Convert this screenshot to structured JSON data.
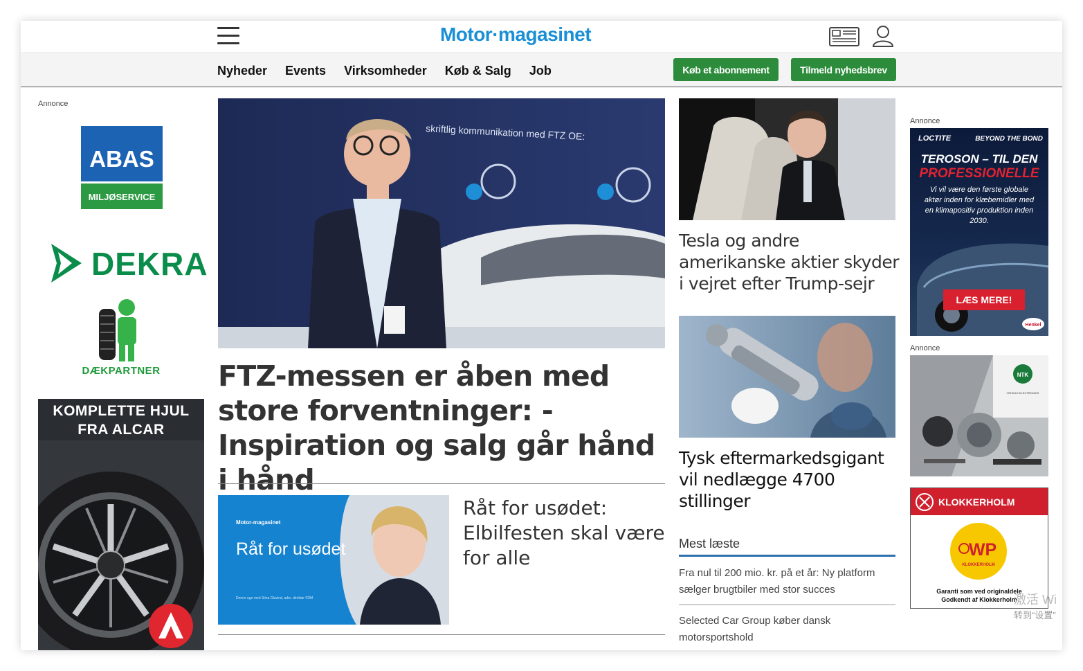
{
  "header": {
    "logo": "Motor·magasinet",
    "nav": [
      "Nyheder",
      "Events",
      "Virksomheder",
      "Køb & Salg",
      "Job"
    ],
    "subscribe_label": "Køb et abonnement",
    "newsletter_label": "Tilmeld nyhedsbrev"
  },
  "ads": {
    "annonce_label": "Annonce",
    "abas_top": "ABAS",
    "abas_bottom": "MILJØSERVICE",
    "dekra": "DEKRA",
    "daekpartner": "DÆKPARTNER",
    "alcar_title": "KOMPLETTE HJUL FRA ALCAR",
    "teroson_brand": "LOCTITE",
    "teroson_tag": "BEYOND THE BOND",
    "teroson_line1": "TEROSON – TIL DEN",
    "teroson_line2": "PROFESSIONELLE",
    "teroson_body": "Vi vil være den første globale aktør inden for klæbemidler med en klimapositiv produktion inden 2030.",
    "teroson_cta": "LÆS MERE!",
    "teroson_henkel": "Henkel",
    "ntk_brand": "NTK",
    "ntk_sub": "VEHICLE ELECTRONICS",
    "klok_name": "KLOKKERHOLM",
    "klok_wp": "WP",
    "klok_wp_sub": "KLOKKERHOLM",
    "klok_line1": "Garanti som ved originaldele",
    "klok_line2": "Godkendt af Klokkerholm"
  },
  "articles": {
    "hero_title": "FTZ-messen er åben med store forventninger: - Inspiration og salg går hånd i hånd",
    "hero_img_banner": "skriftlig kommunikation med FTZ OE:",
    "sub_img_brand": "Motor-magasinet",
    "sub_img_title": "Råt for usødet",
    "sub_img_caption": "Denne uge med Stina Glavind, adm. direktør FDM",
    "sub_title": "Råt for usødet: Elbilfesten skal være for alle",
    "right1_title": "Tesla og andre amerikanske aktier skyder i vejret efter Trump-sejr",
    "right2_title": "Tysk eftermarkedsgigant vil nedlægge 4700 stillinger"
  },
  "most_read": {
    "heading": "Mest læste",
    "items": [
      "Fra nul til 200 mio. kr. på et år: Ny platform sælger brugtbiler med stor succes",
      "Selected Car Group køber dansk motorsportshold"
    ]
  },
  "overlay": {
    "line1": "激活 Wi",
    "line2": "转到“设置”"
  },
  "icons": [
    "menu-icon",
    "e-paper-icon",
    "user-icon"
  ],
  "colors": {
    "brand_blue": "#1a8fd6",
    "button_green": "#2c8c3c",
    "accent_blue": "#2b6fae"
  }
}
